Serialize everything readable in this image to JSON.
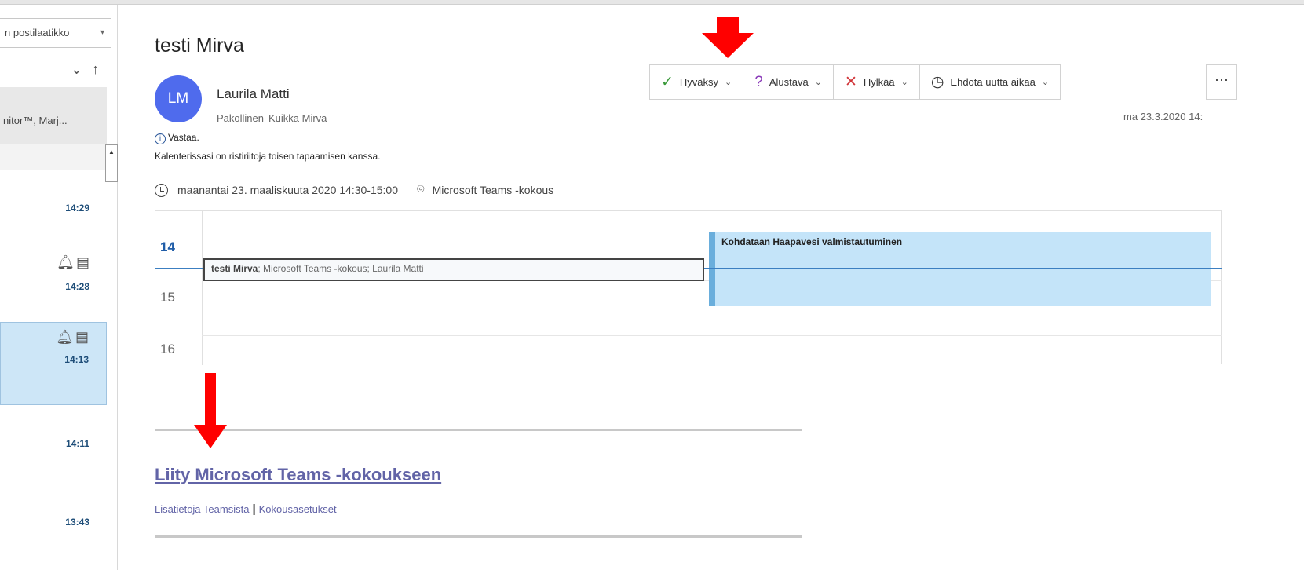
{
  "mail_list": {
    "mailbox_label": "n postilaatikko",
    "group_label": "nitor™, Marj...",
    "items": [
      {
        "time": "14:29"
      },
      {
        "time": "14:28"
      },
      {
        "time": "14:13"
      },
      {
        "time": "14:11"
      },
      {
        "time": "13:43"
      }
    ]
  },
  "message": {
    "subject": "testi Mirva",
    "avatar_initials": "LM",
    "sender": "Laurila Matti",
    "attendee_type": "Pakollinen",
    "attendee_name": "Kuikka Mirva",
    "date_header": "ma 23.3.2020 14:",
    "info_title": "Vastaa.",
    "info_text": "Kalenterissasi on ristiriitoja toisen tapaamisen kanssa.",
    "when": "maanantai 23. maaliskuuta 2020 14:30-15:00",
    "location": "Microsoft Teams -kokous"
  },
  "toolbar": {
    "accept": "Hyväksy",
    "tentative": "Alustava",
    "decline": "Hylkää",
    "propose": "Ehdota uutta aikaa",
    "more": "···"
  },
  "calendar": {
    "hours": [
      "14",
      "15",
      "16"
    ],
    "event_conflict_bold": "testi Mirva",
    "event_conflict_rest": "; Microsoft Teams -kokous; Laurila Matti",
    "event_other": "Kohdataan Haapavesi valmistautuminen"
  },
  "body": {
    "join_link": "Liity Microsoft Teams -kokoukseen",
    "learn_more": "Lisätietoja Teamsista",
    "separator": "|",
    "meeting_options": "Kokousasetukset"
  },
  "colors": {
    "avatar": "#4f6bed",
    "teams_link": "#6264a7",
    "arrow": "#ff0000",
    "event_fill": "#c4e4f9"
  }
}
